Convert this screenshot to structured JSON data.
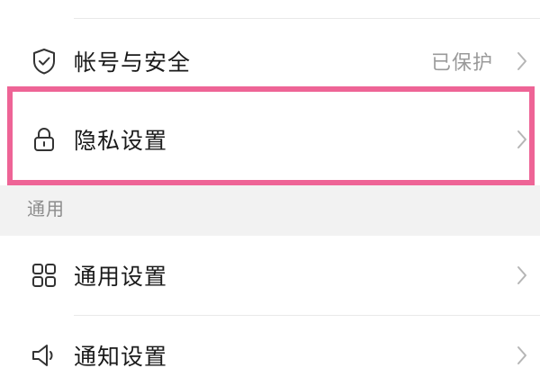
{
  "settings": {
    "account_security": {
      "label": "帐号与安全",
      "value": "已保护",
      "icon": "shield-check-icon"
    },
    "privacy": {
      "label": "隐私设置",
      "icon": "lock-icon"
    },
    "general_section_title": "通用",
    "general_settings": {
      "label": "通用设置",
      "icon": "grid-icon"
    },
    "notification_settings": {
      "label": "通知设置",
      "icon": "speaker-icon"
    }
  },
  "colors": {
    "highlight": "#ee6496",
    "background": "#f2f2f2",
    "card": "#ffffff",
    "label_text": "#1a1a1a",
    "secondary_text": "#9a9a9a"
  }
}
